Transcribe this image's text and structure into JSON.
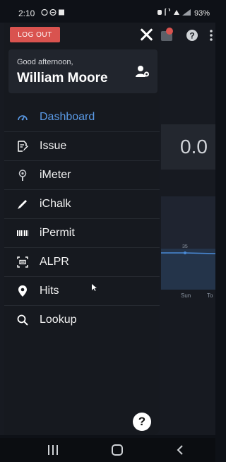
{
  "status_bar": {
    "time": "2:10",
    "battery": "93%"
  },
  "background": {
    "stat_value": "0.0",
    "chart_point_label": "35",
    "axis_labels": [
      "Sun",
      "To"
    ]
  },
  "drawer": {
    "logout_label": "LOG OUT",
    "greeting": "Good afternoon,",
    "user_name": "William Moore",
    "menu": [
      {
        "label": "Dashboard",
        "icon": "gauge-icon",
        "active": true
      },
      {
        "label": "Issue",
        "icon": "edit-document-icon",
        "active": false
      },
      {
        "label": "iMeter",
        "icon": "parking-meter-icon",
        "active": false
      },
      {
        "label": "iChalk",
        "icon": "chalk-icon",
        "active": false
      },
      {
        "label": "iPermit",
        "icon": "barcode-icon",
        "active": false
      },
      {
        "label": "ALPR",
        "icon": "plate-scan-icon",
        "active": false
      },
      {
        "label": "Hits",
        "icon": "location-pin-icon",
        "active": false
      },
      {
        "label": "Lookup",
        "icon": "search-icon",
        "active": false
      }
    ],
    "help_label": "?"
  },
  "colors": {
    "accent": "#5a9ae6",
    "logout": "#d9534f",
    "drawer_bg": "#16191f"
  }
}
